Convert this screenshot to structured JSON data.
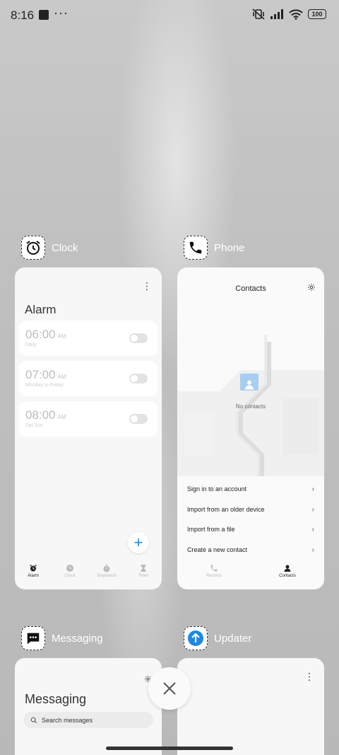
{
  "status_bar": {
    "time": "8:16",
    "overflow": "···",
    "battery": "100"
  },
  "apps": {
    "clock": {
      "name": "Clock",
      "screen_title": "Alarm",
      "alarms": [
        {
          "time": "06:00",
          "ampm": "AM",
          "repeat": "Daily"
        },
        {
          "time": "07:00",
          "ampm": "AM",
          "repeat": "Monday to Friday"
        },
        {
          "time": "08:00",
          "ampm": "AM",
          "repeat": "Sat Sun"
        }
      ],
      "fab_label": "+",
      "tabs": [
        {
          "label": "Alarm",
          "icon": "alarm-icon"
        },
        {
          "label": "Clock",
          "icon": "clock-icon"
        },
        {
          "label": "Stopwatch",
          "icon": "stopwatch-icon"
        },
        {
          "label": "Timer",
          "icon": "hourglass-icon"
        }
      ]
    },
    "phone": {
      "name": "Phone",
      "screen_title": "Contacts",
      "empty_label": "No contacts",
      "actions": [
        "Sign in to an account",
        "Import from an older device",
        "Import from a file",
        "Create a new contact"
      ],
      "tabs": [
        {
          "label": "Recents",
          "icon": "phone-icon"
        },
        {
          "label": "Contacts",
          "icon": "person-icon"
        }
      ]
    },
    "messaging": {
      "name": "Messaging",
      "screen_title": "Messaging",
      "search_placeholder": "Search messages"
    },
    "updater": {
      "name": "Updater"
    }
  },
  "colors": {
    "accent": "#1e88e5",
    "background": "#bdbdbd"
  }
}
